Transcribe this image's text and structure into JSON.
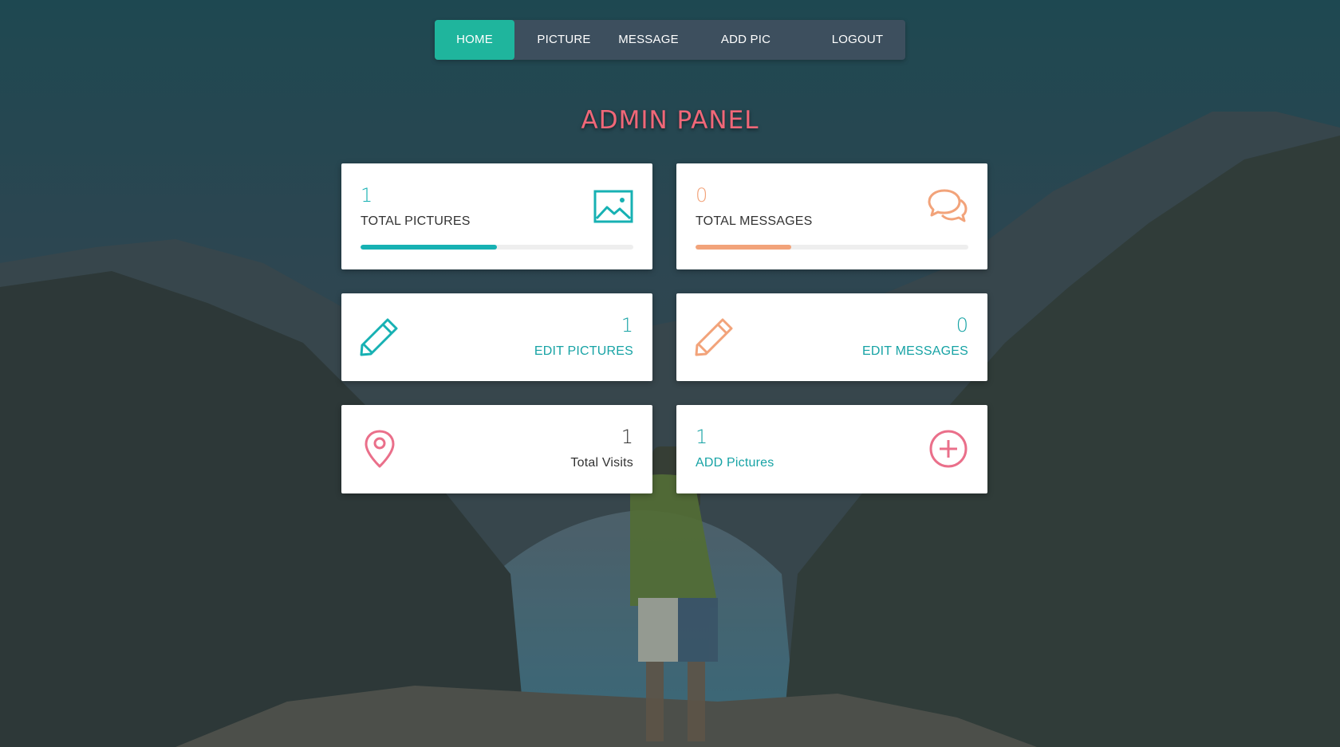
{
  "nav": {
    "items": [
      {
        "label": "HOME",
        "active": true
      },
      {
        "label": "PICTURE",
        "active": false
      },
      {
        "label": "MESSAGE",
        "active": false
      },
      {
        "label": "ADD PIC",
        "active": false
      },
      {
        "label": "LOGOUT",
        "active": false
      }
    ]
  },
  "title": "ADMIN PANEL",
  "cards": {
    "total_pictures": {
      "value": "1",
      "label": "TOTAL PICTURES",
      "progress": 0.5,
      "color": "#17b1b3",
      "icon": "image-icon"
    },
    "total_messages": {
      "value": "0",
      "label": "TOTAL MESSAGES",
      "progress": 0.35,
      "color": "#f2a37a",
      "icon": "chat-bubbles-icon"
    },
    "edit_pictures": {
      "value": "1",
      "label": "EDIT PICTURES",
      "color": "#17a3a5",
      "icon": "pencil-icon"
    },
    "edit_messages": {
      "value": "0",
      "label": "EDIT MESSAGES",
      "color": "#17a3a5",
      "icon_color": "#f2a37a",
      "icon": "pencil-icon"
    },
    "total_visits": {
      "value": "1",
      "label": "Total Visits",
      "color": "#333333",
      "icon_color": "#ea6f8a",
      "icon": "map-pin-icon"
    },
    "add_pictures": {
      "value": "1",
      "label": "ADD Pictures",
      "color": "#17a3a5",
      "icon_color": "#ea6f8a",
      "icon": "plus-circle-icon"
    }
  },
  "colors": {
    "accent": "#1fb59d",
    "teal": "#17b1b3",
    "orange": "#f2a37a",
    "pink": "#ea6f8a",
    "title": "#f06778"
  }
}
